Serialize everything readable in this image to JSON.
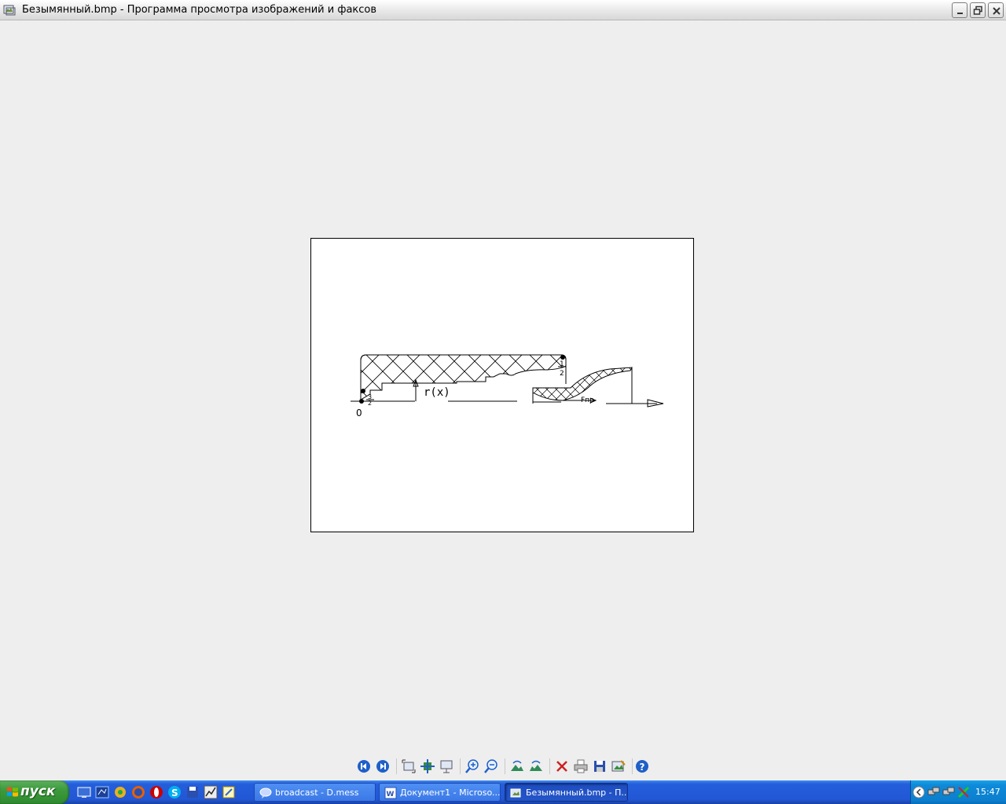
{
  "window": {
    "title": "Безымянный.bmp - Программа просмотра изображений и факсов",
    "buttons": {
      "minimize": "minimize-icon",
      "maximize": "restore-icon",
      "close": "close-icon"
    }
  },
  "drawing": {
    "labels": {
      "origin": "0",
      "point1_top": "1",
      "point1_bottom": "2",
      "point2_top": "3",
      "point2_bottom": "2",
      "radius": "r(x)",
      "fnp": "Fпр"
    }
  },
  "toolbar": {
    "items": [
      "previous-image-icon",
      "next-image-icon",
      "best-fit-icon",
      "actual-size-icon",
      "slideshow-icon",
      "zoom-in-icon",
      "zoom-out-icon",
      "rotate-clockwise-icon",
      "rotate-counterclockwise-icon",
      "delete-icon",
      "print-icon",
      "save-icon",
      "edit-icon",
      "help-icon"
    ]
  },
  "taskbar": {
    "start_label": "пуск",
    "tasks": [
      {
        "label": "broadcast - D.mess",
        "icon": "chat-icon"
      },
      {
        "label": "Документ1 - Microso...",
        "icon": "word-icon"
      },
      {
        "label": "Безымянный.bmp - П...",
        "icon": "image-viewer-icon"
      }
    ],
    "clock": "15:47"
  },
  "colors": {
    "taskbar_blue": "#245edb",
    "start_green": "#3c9a3c",
    "close_red": "#cc2222",
    "toolbar_blue": "#1f5fc8"
  }
}
